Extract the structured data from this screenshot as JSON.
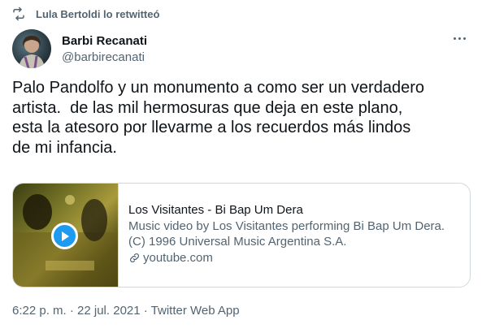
{
  "retweet": {
    "label": "Lula Bertoldi lo retwitteó"
  },
  "author": {
    "name": "Barbi Recanati",
    "handle": "@barbirecanati"
  },
  "tweet": {
    "text": "Palo Pandolfo y un monumento a como ser un verdadero\nartista.  de las mil hermosuras que deja en este plano,\nesta la atesoro por llevarme a los recuerdos más lindos\nde mi infancia."
  },
  "card": {
    "title": "Los Visitantes - Bi Bap Um Dera",
    "description_line1": "Music video by Los Visitantes performing Bi Bap Um Dera.",
    "description_line2": "(C) 1996 Universal Music Argentina S.A.",
    "domain": "youtube.com"
  },
  "meta": {
    "text": "6:22 p. m. · 22 jul. 2021 · Twitter Web App"
  },
  "colors": {
    "accent": "#1d9bf0",
    "secondary_text": "#536471",
    "border": "#cfd9de"
  },
  "icons": [
    "retweet-icon",
    "more-icon",
    "play-icon",
    "link-icon"
  ]
}
